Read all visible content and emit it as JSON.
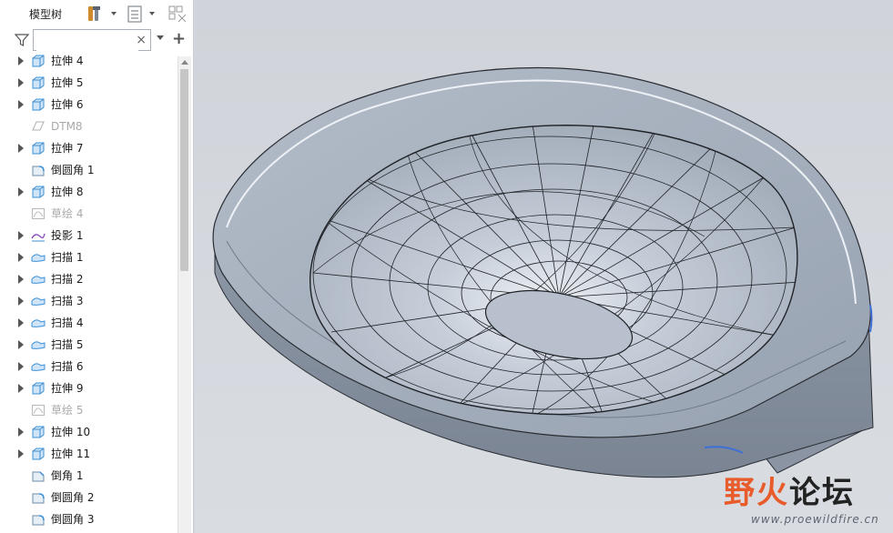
{
  "panel": {
    "title": "模型树",
    "search": {
      "value": "",
      "placeholder": ""
    },
    "clear_symbol": "×",
    "add_symbol": "+"
  },
  "tree": {
    "items": [
      {
        "label": "拉伸 4",
        "icon": "extrude-icon",
        "expandable": true,
        "dim": false
      },
      {
        "label": "拉伸 5",
        "icon": "extrude-icon",
        "expandable": true,
        "dim": false
      },
      {
        "label": "拉伸 6",
        "icon": "extrude-icon",
        "expandable": true,
        "dim": false
      },
      {
        "label": "DTM8",
        "icon": "datum-plane-icon",
        "expandable": false,
        "dim": true
      },
      {
        "label": "拉伸 7",
        "icon": "extrude-icon",
        "expandable": true,
        "dim": false
      },
      {
        "label": "倒圆角 1",
        "icon": "round-icon",
        "expandable": false,
        "dim": false
      },
      {
        "label": "拉伸 8",
        "icon": "extrude-icon",
        "expandable": true,
        "dim": false
      },
      {
        "label": "草绘 4",
        "icon": "sketch-icon",
        "expandable": false,
        "dim": true
      },
      {
        "label": "投影 1",
        "icon": "projection-icon",
        "expandable": true,
        "dim": false
      },
      {
        "label": "扫描 1",
        "icon": "sweep-icon",
        "expandable": true,
        "dim": false
      },
      {
        "label": "扫描 2",
        "icon": "sweep-icon",
        "expandable": true,
        "dim": false
      },
      {
        "label": "扫描 3",
        "icon": "sweep-icon",
        "expandable": true,
        "dim": false
      },
      {
        "label": "扫描 4",
        "icon": "sweep-icon",
        "expandable": true,
        "dim": false
      },
      {
        "label": "扫描 5",
        "icon": "sweep-icon",
        "expandable": true,
        "dim": false
      },
      {
        "label": "扫描 6",
        "icon": "sweep-icon",
        "expandable": true,
        "dim": false
      },
      {
        "label": "拉伸 9",
        "icon": "extrude-icon",
        "expandable": true,
        "dim": false
      },
      {
        "label": "草绘 5",
        "icon": "sketch-icon",
        "expandable": false,
        "dim": true
      },
      {
        "label": "拉伸 10",
        "icon": "extrude-icon",
        "expandable": true,
        "dim": false
      },
      {
        "label": "拉伸 11",
        "icon": "extrude-icon",
        "expandable": true,
        "dim": false
      },
      {
        "label": "倒角 1",
        "icon": "chamfer-icon",
        "expandable": false,
        "dim": false
      },
      {
        "label": "倒圆角 2",
        "icon": "round-icon",
        "expandable": false,
        "dim": false
      },
      {
        "label": "倒圆角 3",
        "icon": "round-icon",
        "expandable": false,
        "dim": false
      }
    ]
  },
  "watermark": {
    "part1": "野火",
    "part2": "论坛",
    "url": "www.proewildfire.cn"
  },
  "colors": {
    "model_face": "#a3adbb",
    "model_edge": "#2a2d33",
    "icon_blue": "#3d8fd6",
    "watermark_orange": "#e85c2b"
  }
}
